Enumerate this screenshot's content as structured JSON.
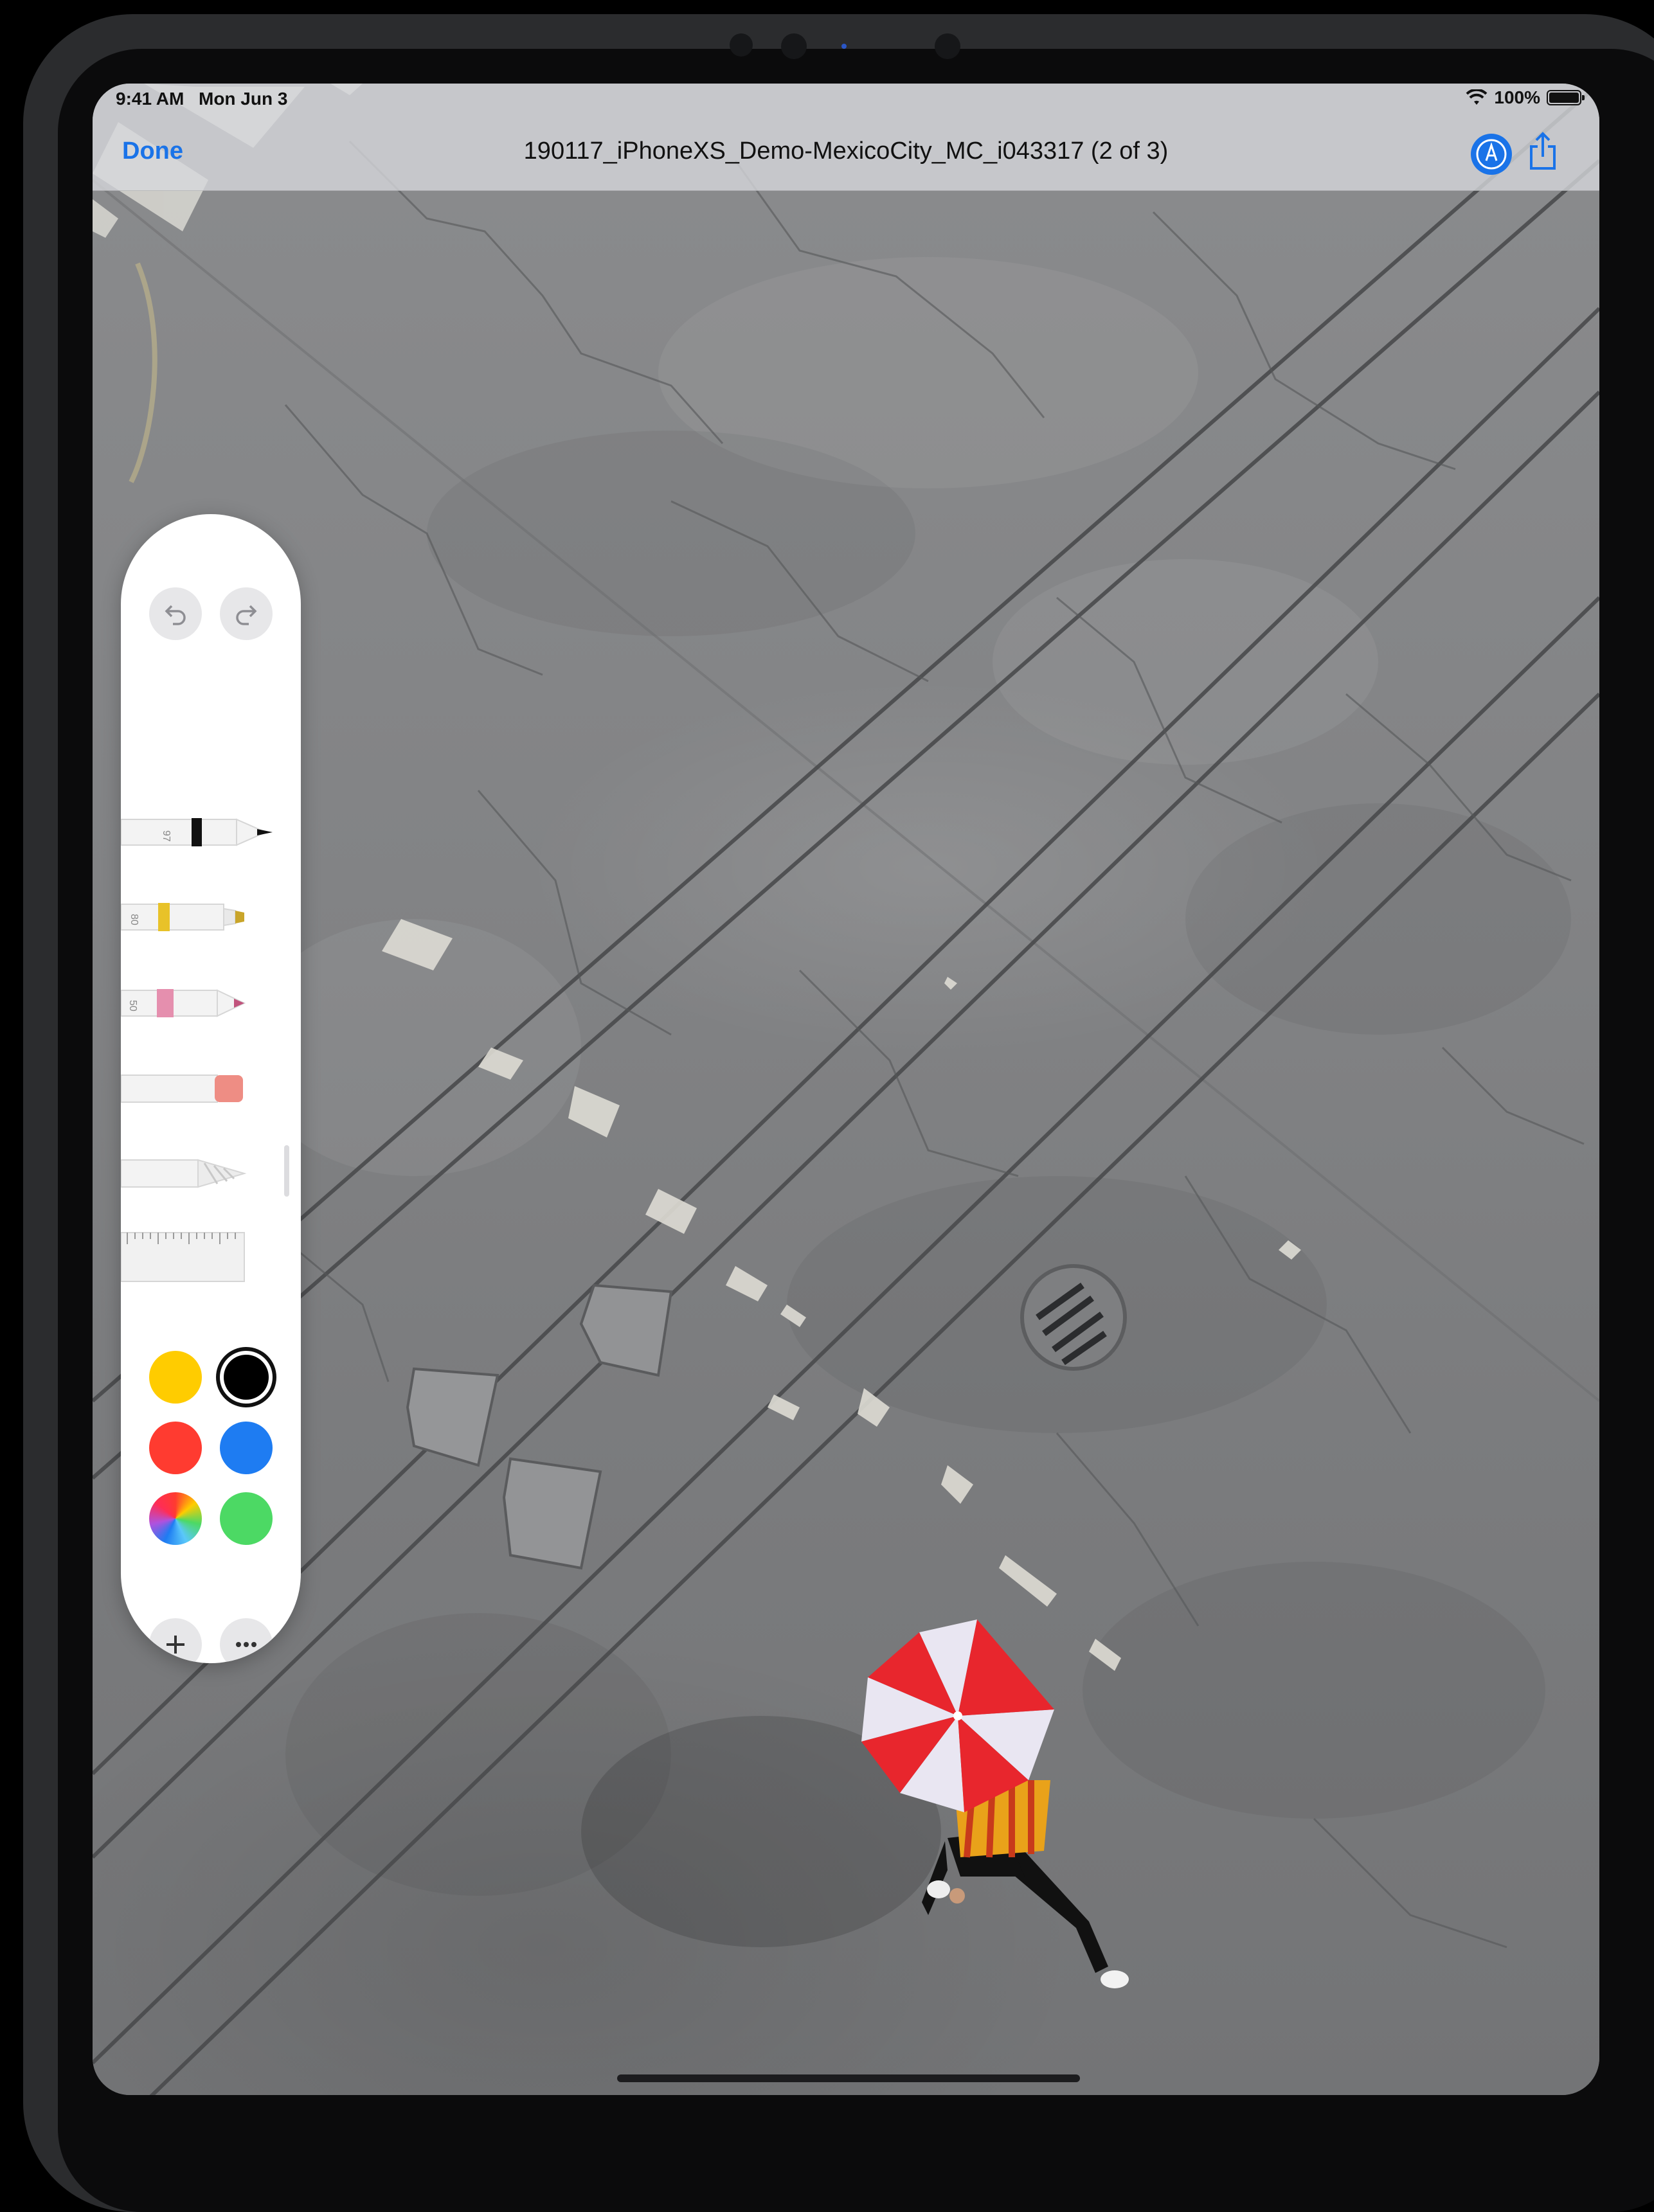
{
  "status_bar": {
    "time": "9:41 AM",
    "date": "Mon Jun 3",
    "battery_percent": "100%",
    "battery_level": 1.0
  },
  "nav_bar": {
    "done_label": "Done",
    "title": "190117_iPhoneXS_Demo-MexicoCity_MC_i043317 (2 of 3)",
    "markup_icon": "markup-pen-icon",
    "share_icon": "share-icon"
  },
  "tool_palette": {
    "undo_icon": "undo-icon",
    "redo_icon": "redo-icon",
    "tools": [
      {
        "name": "pen",
        "label": "97"
      },
      {
        "name": "marker",
        "label": "80"
      },
      {
        "name": "pencil",
        "label": "50"
      },
      {
        "name": "eraser",
        "label": ""
      },
      {
        "name": "lasso",
        "label": ""
      },
      {
        "name": "ruler",
        "label": ""
      }
    ],
    "colors": [
      {
        "name": "yellow",
        "hex": "#ffcc00"
      },
      {
        "name": "black",
        "hex": "#000000",
        "selected": true
      },
      {
        "name": "red",
        "hex": "#ff3b30"
      },
      {
        "name": "blue",
        "hex": "#1e7cf2"
      },
      {
        "name": "multicolor",
        "hex": "conic"
      },
      {
        "name": "green",
        "hex": "#4cd964"
      }
    ],
    "add_icon": "plus-icon",
    "more_icon": "ellipsis-icon"
  },
  "colors": {
    "accent": "#1a73e8",
    "umbrella_red": "#e8262d",
    "umbrella_white": "#e9e6f2"
  }
}
